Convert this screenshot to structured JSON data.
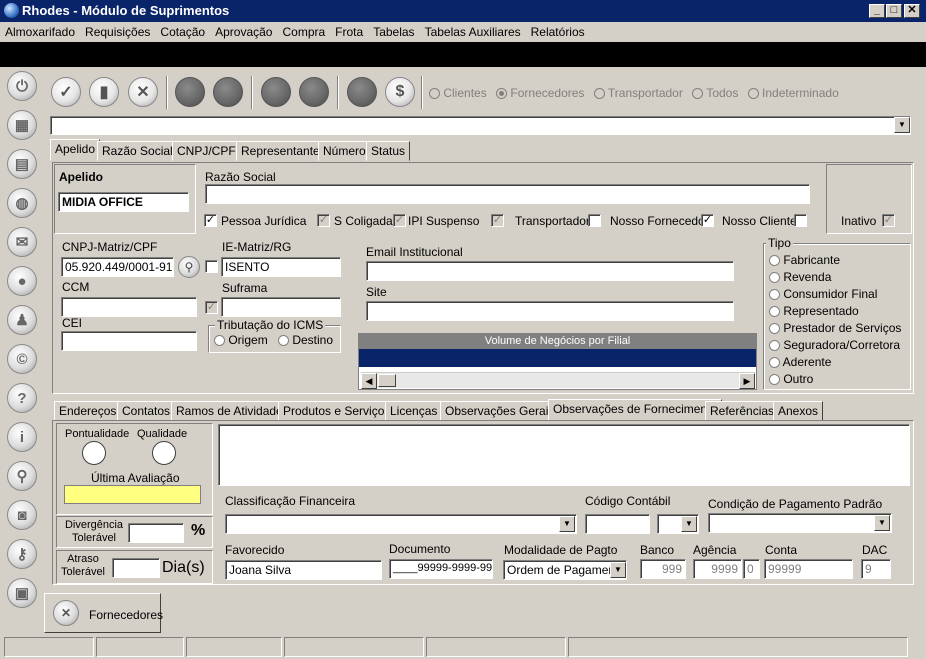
{
  "window": {
    "title": "Rhodes - Módulo de Suprimentos",
    "min": "_",
    "max": "□",
    "close": "✕"
  },
  "menu": [
    "Almoxarifado",
    "Requisições",
    "Cotação",
    "Aprovação",
    "Compra",
    "Frota",
    "Tabelas",
    "Tabelas Auxiliares",
    "Relatórios"
  ],
  "toolbar": {
    "radios": [
      "Clientes",
      "Fornecedores",
      "Transportador",
      "Todos",
      "Indeterminado"
    ],
    "selected_radio": "Fornecedores",
    "dollar": "$"
  },
  "top_tabs": [
    "Apelido",
    "Razão Social",
    "CNPJ/CPF",
    "Representante",
    "Número",
    "Status"
  ],
  "form": {
    "apelido_label": "Apelido",
    "apelido_value": "MIDIA OFFICE",
    "razao_label": "Razão Social",
    "razao_value": "",
    "chk_labels": [
      "Pessoa Jurídica",
      "S Coligada",
      "IPI Suspenso",
      "Transportador",
      "Nosso Fornecedor",
      "Nosso Cliente"
    ],
    "inativo_label": "Inativo",
    "cnpj_label": "CNPJ-Matriz/CPF",
    "cnpj_value": "05.920.449/0001-91",
    "ie_label": "IE-Matriz/RG",
    "ie_value": "ISENTO",
    "ccm_label": "CCM",
    "suframa_label": "Suframa",
    "cei_label": "CEI",
    "icms_label": "Tributação do ICMS",
    "icms_origem": "Origem",
    "icms_destino": "Destino",
    "email_label": "Email Institucional",
    "site_label": "Site",
    "volume_label": "Volume de Negócios por Filial",
    "tipo_label": "Tipo",
    "tipo_options": [
      "Fabricante",
      "Revenda",
      "Consumidor Final",
      "Representado",
      "Prestador de Serviços",
      "Seguradora/Corretora",
      "Aderente",
      "Outro"
    ]
  },
  "bottom_tabs": [
    "Endereços",
    "Contatos",
    "Ramos de Atividade",
    "Produtos e Serviços",
    "Licenças",
    "Observações Gerais",
    "Observações de Fornecimento",
    "Referências",
    "Anexos"
  ],
  "active_bottom_tab": "Observações de Fornecimento",
  "eval": {
    "pontualidade": "Pontualidade",
    "qualidade": "Qualidade",
    "ultima": "Última Avaliação",
    "divergencia": "Divergência Tolerável",
    "pct": "%",
    "atraso": "Atraso Tolerável",
    "dias": "Dia(s)",
    "highlight_color": "#ffff80"
  },
  "finance": {
    "class_label": "Classificação Financeira",
    "contabil_label": "Código Contábil",
    "condicao_label": "Condição de Pagamento Padrão",
    "favorecido_label": "Favorecido",
    "favorecido_value": "Joana Silva",
    "documento_label": "Documento",
    "documento_value": "____99999-9999-99",
    "modalidade_label": "Modalidade de Pagto",
    "modalidade_value": "Ordem de Pagamento",
    "banco_label": "Banco",
    "banco_value": "999",
    "agencia_label": "Agência",
    "agencia_value": "9999",
    "agencia_dv": "0",
    "conta_label": "Conta",
    "conta_value": "99999",
    "dac_label": "DAC",
    "dac_value": "9"
  },
  "taskbar": {
    "tab_label": "Fornecedores"
  },
  "colors": {
    "title_bar": "#0a246a",
    "grid_header": "#0a246a",
    "face": "#d4d0c8"
  }
}
